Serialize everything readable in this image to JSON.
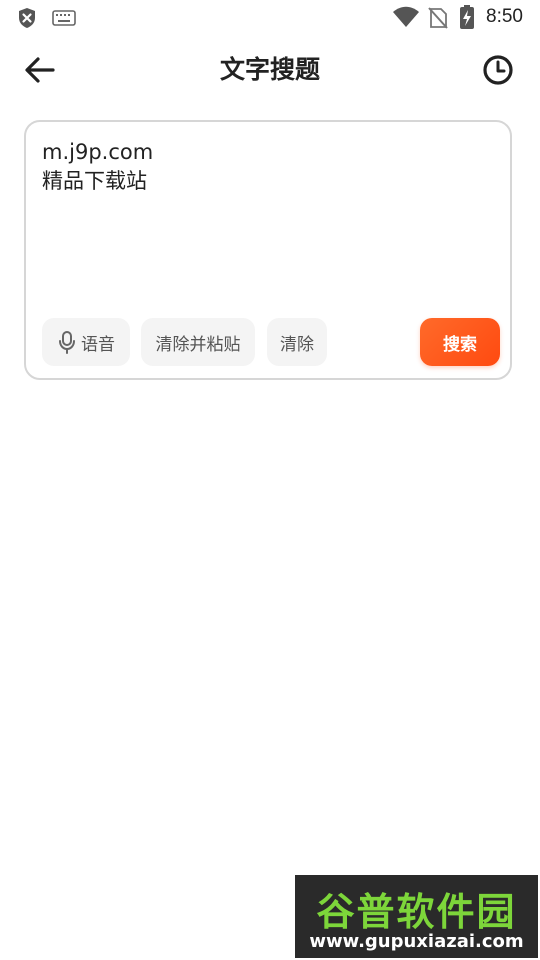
{
  "status_bar": {
    "time": "8:50",
    "icons": [
      "shield-x-icon",
      "keyboard-icon",
      "wifi-icon",
      "no-sim-icon",
      "battery-charging-icon"
    ]
  },
  "header": {
    "title": "文字搜题",
    "back_icon": "arrow-left-icon",
    "history_icon": "clock-icon"
  },
  "search_card": {
    "query_value": "m.j9p.com\n精品下载站",
    "voice_label": "语音",
    "voice_icon": "microphone-icon",
    "clear_paste_label": "清除并粘贴",
    "clear_label": "清除",
    "search_label": "搜索"
  },
  "watermark": {
    "title": "谷普软件园",
    "url": "www.gupuxiazai.com"
  },
  "colors": {
    "accent": "#ff5a1a",
    "chip_bg": "#f4f4f4",
    "card_border": "#d6d6d6",
    "text": "#222222"
  }
}
